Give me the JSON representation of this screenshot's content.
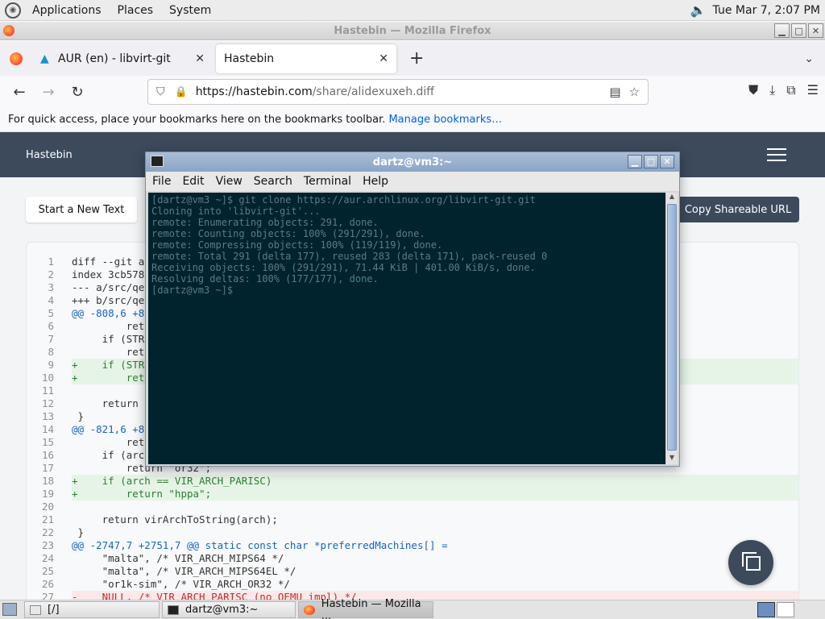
{
  "top_panel": {
    "menus": [
      "Applications",
      "Places",
      "System"
    ],
    "clock": "Tue Mar  7,  2:07 PM"
  },
  "firefox": {
    "window_title": "Hastebin — Mozilla Firefox",
    "tabs": [
      {
        "label": "AUR (en) - libvirt-git"
      },
      {
        "label": "Hastebin"
      }
    ],
    "url_host": "https://hastebin.com",
    "url_path": "/share/alidexuxeh.diff",
    "bookmarks_hint": "For quick access, place your bookmarks here on the bookmarks toolbar.",
    "manage_bookmarks": "Manage bookmarks…"
  },
  "hastebin": {
    "brand": "Hastebin",
    "new_text_button": "Start a New Text",
    "copy_url_button": "Copy Shareable URL",
    "lines": [
      {
        "n": "1",
        "t": "diff --git a",
        "k": "ctx"
      },
      {
        "n": "2",
        "t": "index 3cb578",
        "k": "ctx"
      },
      {
        "n": "3",
        "t": "--- a/src/qe",
        "k": "ctx"
      },
      {
        "n": "4",
        "t": "+++ b/src/qe",
        "k": "ctx"
      },
      {
        "n": "5",
        "t": "@@ -808,6 +8",
        "k": "hunk"
      },
      {
        "n": "6",
        "t": "         ret",
        "k": "ctx"
      },
      {
        "n": "7",
        "t": "     if (STR",
        "k": "ctx"
      },
      {
        "n": "8",
        "t": "         ret",
        "k": "ctx"
      },
      {
        "n": "9",
        "t": "+    if (STR",
        "k": "add"
      },
      {
        "n": "10",
        "t": "+        ret",
        "k": "add"
      },
      {
        "n": "11",
        "t": "",
        "k": "ctx"
      },
      {
        "n": "12",
        "t": "     return ",
        "k": "ctx"
      },
      {
        "n": "13",
        "t": " }",
        "k": "ctx"
      },
      {
        "n": "14",
        "t": "@@ -821,6 +8",
        "k": "hunk"
      },
      {
        "n": "15",
        "t": "         ret",
        "k": "ctx"
      },
      {
        "n": "16",
        "t": "     if (arc",
        "k": "ctx"
      },
      {
        "n": "17",
        "t": "         return \"or32\";",
        "k": "ctx"
      },
      {
        "n": "18",
        "t": "+    if (arch == VIR_ARCH_PARISC)",
        "k": "add"
      },
      {
        "n": "19",
        "t": "+        return \"hppa\";",
        "k": "add"
      },
      {
        "n": "20",
        "t": "",
        "k": "ctx"
      },
      {
        "n": "21",
        "t": "     return virArchToString(arch);",
        "k": "ctx"
      },
      {
        "n": "22",
        "t": " }",
        "k": "ctx"
      },
      {
        "n": "23",
        "t": "@@ -2747,7 +2751,7 @@ static const char *preferredMachines[] =",
        "k": "hunk"
      },
      {
        "n": "24",
        "t": "     \"malta\", /* VIR_ARCH_MIPS64 */",
        "k": "ctx"
      },
      {
        "n": "25",
        "t": "     \"malta\", /* VIR_ARCH_MIPS64EL */",
        "k": "ctx"
      },
      {
        "n": "26",
        "t": "     \"or1k-sim\", /* VIR_ARCH_OR32 */",
        "k": "ctx"
      },
      {
        "n": "27",
        "t": "-    NULL, /* VIR_ARCH_PARISC (no QEMU impl) */",
        "k": "del"
      }
    ]
  },
  "terminal": {
    "title": "dartz@vm3:~",
    "menus": [
      "File",
      "Edit",
      "View",
      "Search",
      "Terminal",
      "Help"
    ],
    "output": [
      "[dartz@vm3 ~]$ git clone https://aur.archlinux.org/libvirt-git.git",
      "Cloning into 'libvirt-git'...",
      "remote: Enumerating objects: 291, done.",
      "remote: Counting objects: 100% (291/291), done.",
      "remote: Compressing objects: 100% (119/119), done.",
      "remote: Total 291 (delta 177), reused 283 (delta 171), pack-reused 0",
      "Receiving objects: 100% (291/291), 71.44 KiB | 401.00 KiB/s, done.",
      "Resolving deltas: 100% (177/177), done.",
      "[dartz@vm3 ~]$ "
    ]
  },
  "taskbar": {
    "items": [
      "[/]",
      "dartz@vm3:~",
      "Hastebin — Mozilla ..."
    ]
  }
}
